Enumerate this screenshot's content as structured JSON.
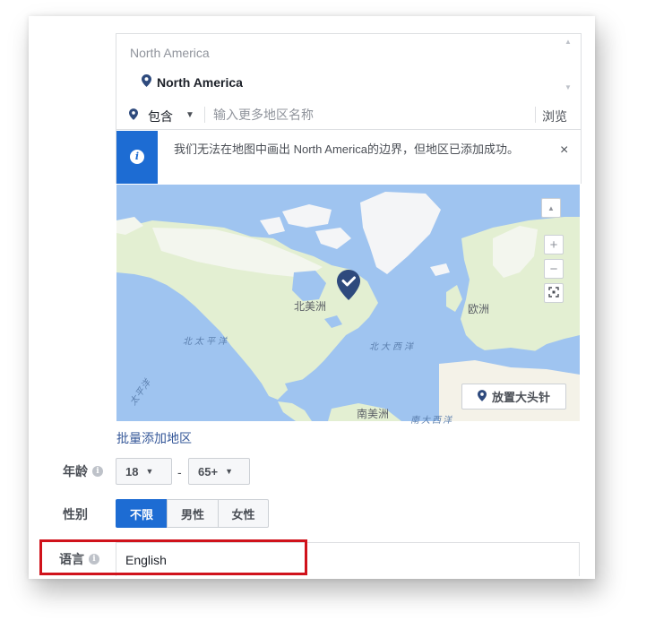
{
  "location": {
    "header": "North America",
    "selected": "North America",
    "include_label": "包含",
    "search_placeholder": "输入更多地区名称",
    "browse_label": "浏览"
  },
  "banner": {
    "message": "我们无法在地图中画出 North America的边界，但地区已添加成功。",
    "close_symbol": "×"
  },
  "map": {
    "labels": {
      "north_america": "北美洲",
      "europe": "欧洲",
      "south_america": "南美洲",
      "north_pacific": "北太平洋",
      "north_atlantic": "北大西洋",
      "south_atlantic": "南大西洋",
      "pacific": "太平洋"
    },
    "zoom_in": "+",
    "zoom_out": "−",
    "drop_pin_label": "放置大头针"
  },
  "bulk_add_link": "批量添加地区",
  "age": {
    "label": "年龄",
    "min": "18",
    "max": "65+",
    "separator": "-"
  },
  "gender": {
    "label": "性别",
    "options": [
      "不限",
      "男性",
      "女性"
    ],
    "selected": "不限"
  },
  "language": {
    "label": "语言",
    "value": "English"
  },
  "colors": {
    "accent": "#1d6cd3",
    "highlight": "#d0121b",
    "link": "#365899",
    "pin": "#2e4a7d"
  },
  "info_icon_glyph": "i"
}
